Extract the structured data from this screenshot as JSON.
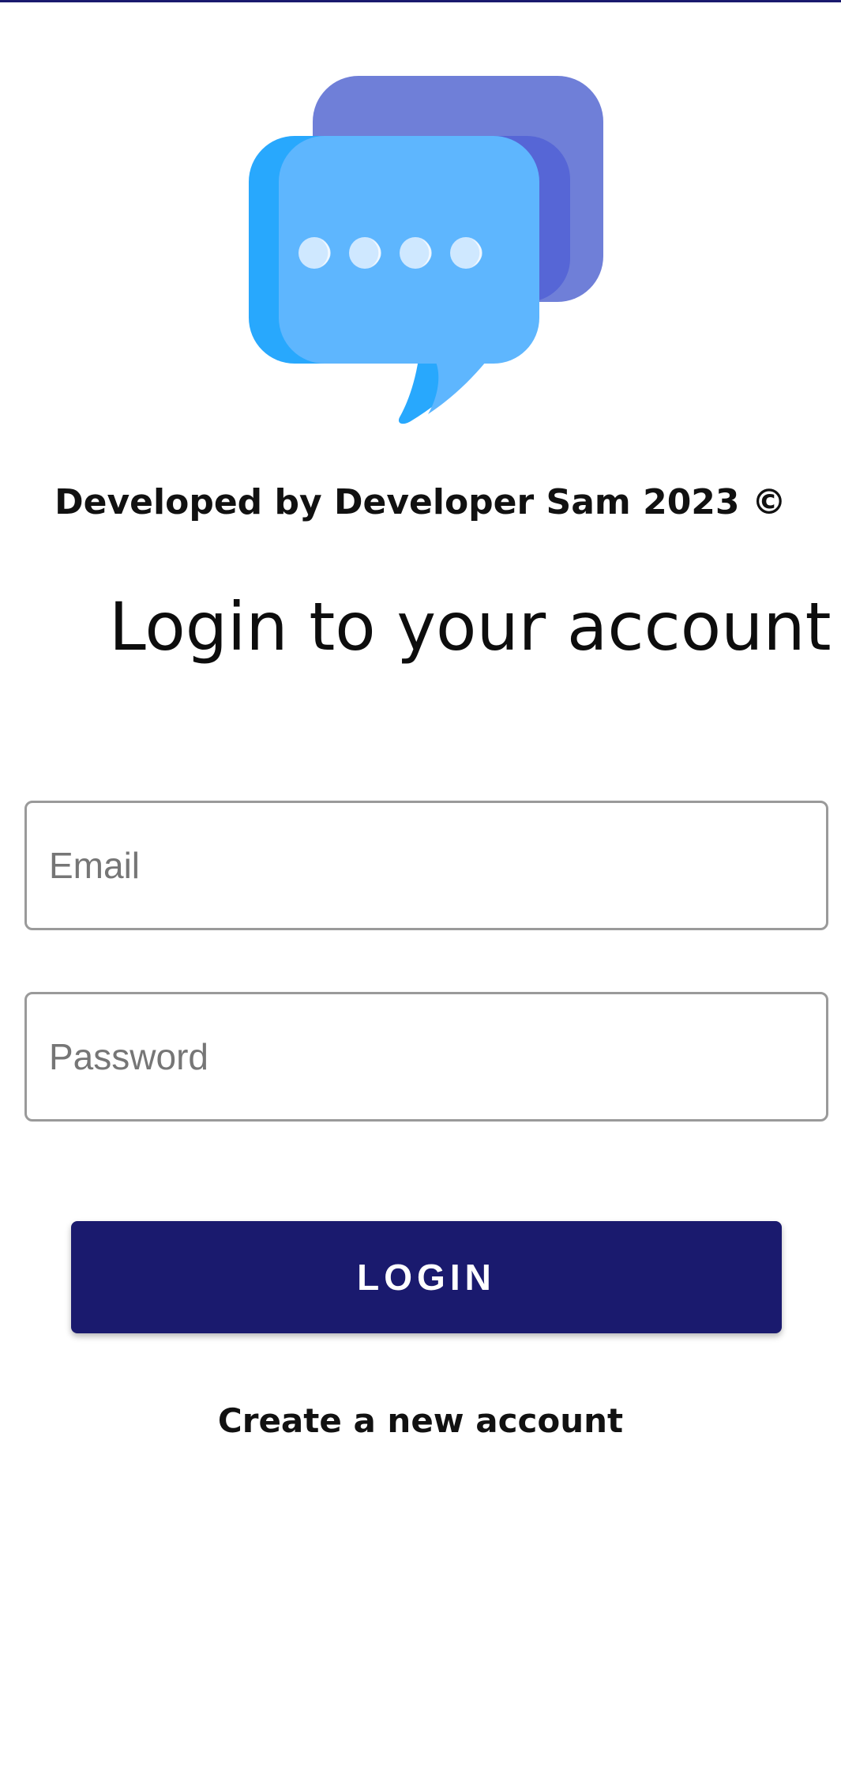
{
  "app": {
    "credit_text": "Developed by Developer Sam 2023 ©",
    "heading": "Login to your account"
  },
  "form": {
    "email_placeholder": "Email",
    "email_value": "",
    "password_placeholder": "Password",
    "password_value": "",
    "login_label": "LOGIN",
    "create_account_label": "Create a new account"
  },
  "icons": {
    "logo": "chat-bubbles-icon"
  },
  "colors": {
    "accent": "#1a1a6e",
    "bubble_back": "#6f7fd8",
    "bubble_front": "#5eb6fe",
    "bubble_front_dark": "#28a8fd",
    "field_border": "#9a9a9a",
    "text_primary": "#111111",
    "placeholder": "#767676"
  }
}
